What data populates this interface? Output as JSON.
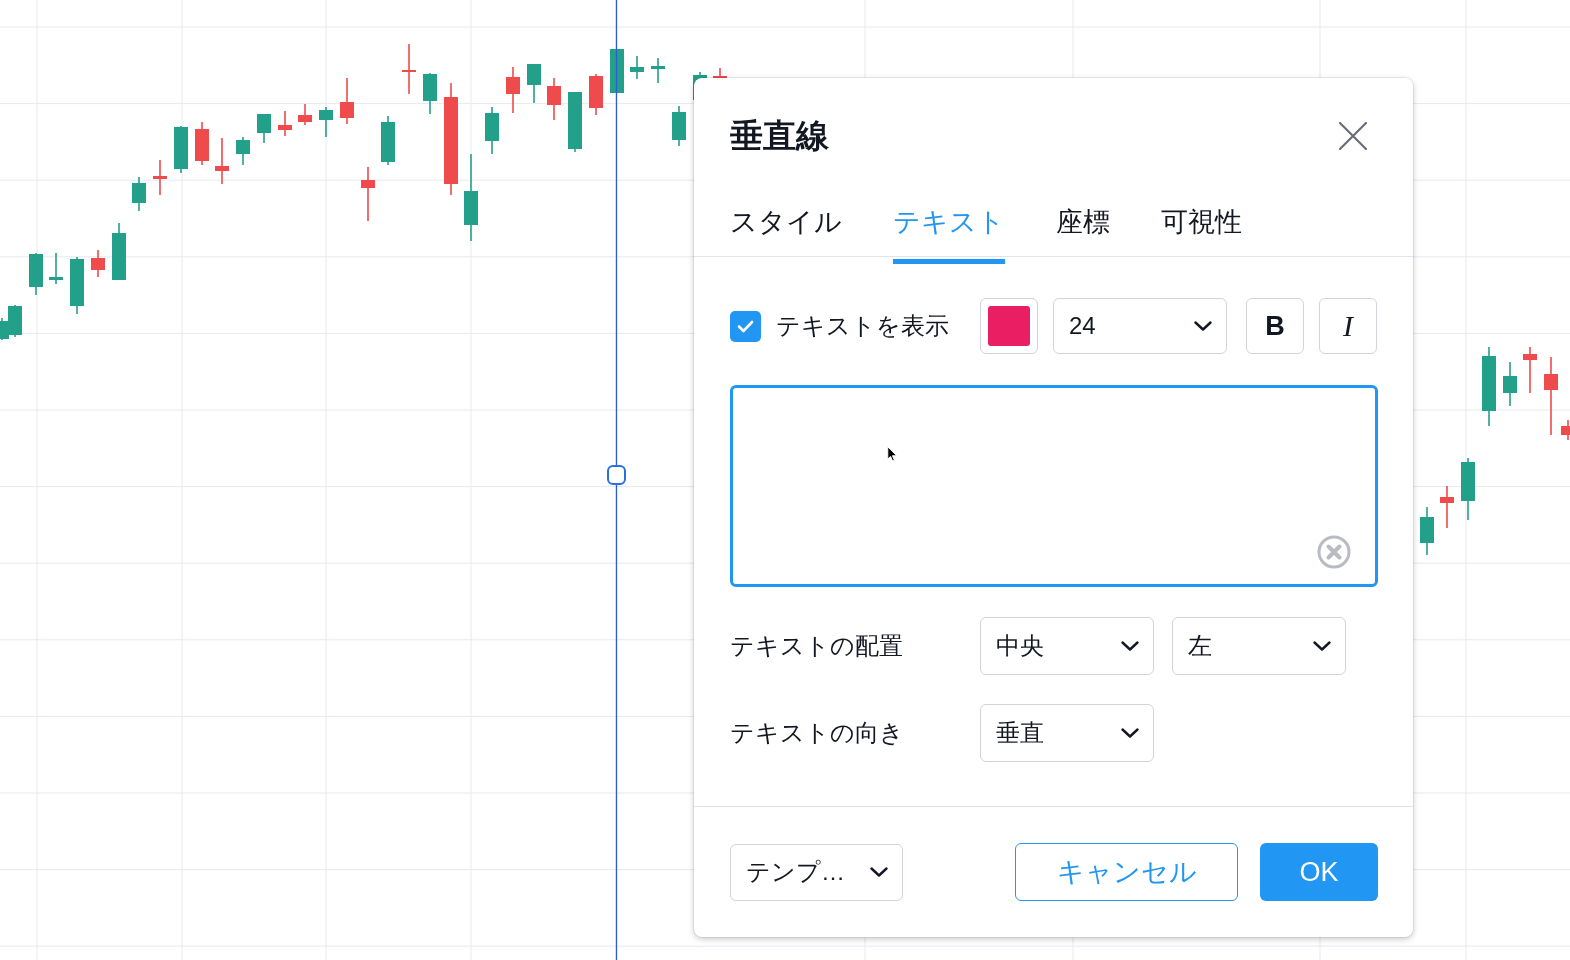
{
  "dialog": {
    "title": "垂直線",
    "tabs": [
      {
        "label": "スタイル",
        "selected": false
      },
      {
        "label": "テキスト",
        "selected": true
      },
      {
        "label": "座標",
        "selected": false
      },
      {
        "label": "可視性",
        "selected": false
      }
    ],
    "show_text": {
      "label": "テキストを表示",
      "checked": true
    },
    "text_color": {
      "color": "#e91e63"
    },
    "font_size": "24",
    "style_buttons": [
      {
        "label": "B",
        "kind": "bold"
      },
      {
        "label": "I",
        "kind": "italic"
      }
    ],
    "text_field": {
      "focused": true
    },
    "settings": [
      {
        "label": "テキストの配置",
        "selects": [
          "中央",
          "左"
        ]
      },
      {
        "label": "テキストの向き",
        "selects": [
          "垂直"
        ]
      }
    ],
    "template_select": "テンプ…",
    "buttons": [
      {
        "label": "キャンセル",
        "kind": "secondary"
      },
      {
        "label": "OK",
        "kind": "primary"
      }
    ]
  }
}
